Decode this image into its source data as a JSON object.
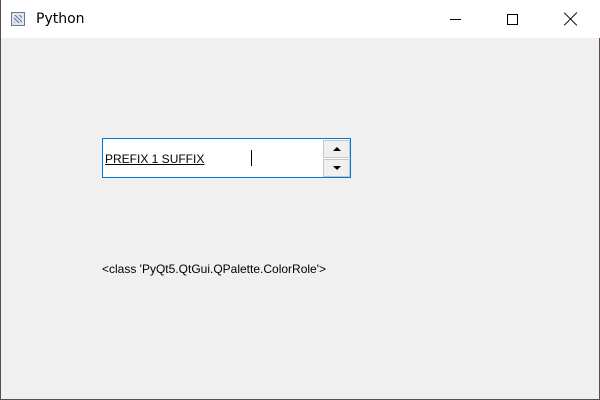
{
  "window": {
    "title": "Python",
    "icon": "python-app-icon"
  },
  "controls": {
    "minimize_icon": "minimize-icon",
    "maximize_icon": "maximize-icon",
    "close_icon": "close-icon"
  },
  "spinbox": {
    "value": "PREFIX 1 SUFFIX",
    "up_icon": "chevron-up-icon",
    "down_icon": "chevron-down-icon",
    "accent": "#0078d7"
  },
  "label": {
    "text": "<class 'PyQt5.QtGui.QPalette.ColorRole'>"
  }
}
